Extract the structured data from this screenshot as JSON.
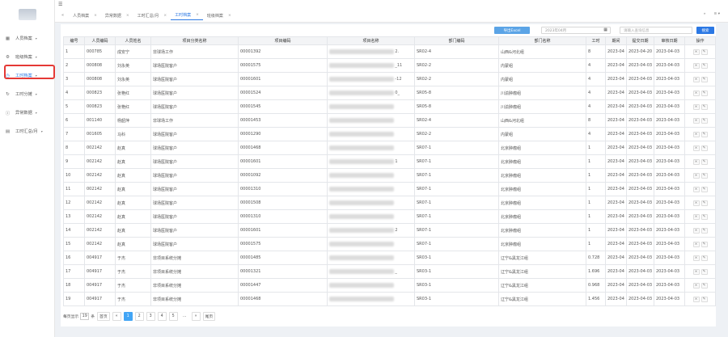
{
  "sidebar": {
    "items": [
      {
        "label": "人员档案",
        "icon": "grid-icon"
      },
      {
        "label": "班级档案",
        "icon": "settings-icon"
      },
      {
        "label": "工时档案",
        "icon": "clock-icon"
      },
      {
        "label": "工时分摊",
        "icon": "refresh-icon"
      },
      {
        "label": "异常数据",
        "icon": "info-icon"
      },
      {
        "label": "工时汇总/月",
        "icon": "calendar-icon"
      }
    ]
  },
  "tabs": [
    "人员档案",
    "异常数据",
    "工时汇总/月",
    "工时档案",
    "班级档案"
  ],
  "toolbar": {
    "export_label": "导出Excel",
    "month_value": "2023年04月",
    "search_placeholder": "请输入查询信息",
    "search_label": "搜索"
  },
  "columns": [
    "编号",
    "人员编码",
    "人员姓名",
    "项目分类名称",
    "项目编码",
    "项目名称",
    "部门编码",
    "部门名称",
    "工时",
    "期间",
    "提交日期",
    "审核日期",
    "操作"
  ],
  "rows": [
    {
      "no": "1",
      "code": "000785",
      "name": "成安宁",
      "cat": "非球场工作",
      "pcode": "00001392",
      "psfx": "2.",
      "dcode": "SR02-4",
      "dname": "山西&河北组",
      "hours": "8",
      "period": "2023-04",
      "submit": "2023-04-20",
      "audit": "2023-04-03"
    },
    {
      "no": "2",
      "code": "000808",
      "name": "刘永英",
      "cat": "球场医院客户",
      "pcode": "00001575",
      "psfx": "_11",
      "dcode": "SR02-2",
      "dname": "内蒙组",
      "hours": "4",
      "period": "2023-04",
      "submit": "2023-04-03",
      "audit": "2023-04-03"
    },
    {
      "no": "3",
      "code": "000808",
      "name": "刘永英",
      "cat": "球场医院客户",
      "pcode": "00001601",
      "psfx": "-12",
      "dcode": "SR02-2",
      "dname": "内蒙组",
      "hours": "4",
      "period": "2023-04",
      "submit": "2023-04-03",
      "audit": "2023-04-03"
    },
    {
      "no": "4",
      "code": "000823",
      "name": "张艳红",
      "cat": "球场医院客户",
      "pcode": "00001524",
      "psfx": "0_",
      "dcode": "SR05-8",
      "dname": "川渝肿瘤组",
      "hours": "4",
      "period": "2023-04",
      "submit": "2023-04-03",
      "audit": "2023-04-03"
    },
    {
      "no": "5",
      "code": "000823",
      "name": "张艳红",
      "cat": "球场医院客户",
      "pcode": "00001545",
      "psfx": "",
      "dcode": "SR05-8",
      "dname": "川渝肿瘤组",
      "hours": "4",
      "period": "2023-04",
      "submit": "2023-04-03",
      "audit": "2023-04-03"
    },
    {
      "no": "6",
      "code": "001140",
      "name": "杨韶萍",
      "cat": "非球场工作",
      "pcode": "00001453",
      "psfx": "",
      "dcode": "SR02-4",
      "dname": "山西&河北组",
      "hours": "8",
      "period": "2023-04",
      "submit": "2023-04-03",
      "audit": "2023-04-03"
    },
    {
      "no": "7",
      "code": "001605",
      "name": "马科",
      "cat": "球场医院客户",
      "pcode": "00001290",
      "psfx": "",
      "dcode": "SR02-2",
      "dname": "内蒙组",
      "hours": "4",
      "period": "2023-04",
      "submit": "2023-04-03",
      "audit": "2023-04-03"
    },
    {
      "no": "8",
      "code": "002142",
      "name": "赵真",
      "cat": "球场医院客户",
      "pcode": "00001468",
      "psfx": "",
      "dcode": "SR07-1",
      "dname": "北京肿瘤组",
      "hours": "1",
      "period": "2023-04",
      "submit": "2023-04-03",
      "audit": "2023-04-03"
    },
    {
      "no": "9",
      "code": "002142",
      "name": "赵真",
      "cat": "球场医院客户",
      "pcode": "00001601",
      "psfx": "1",
      "dcode": "SR07-1",
      "dname": "北京肿瘤组",
      "hours": "1",
      "period": "2023-04",
      "submit": "2023-04-03",
      "audit": "2023-04-03"
    },
    {
      "no": "10",
      "code": "002142",
      "name": "赵真",
      "cat": "球场医院客户",
      "pcode": "00001092",
      "psfx": "",
      "dcode": "SR07-1",
      "dname": "北京肿瘤组",
      "hours": "1",
      "period": "2023-04",
      "submit": "2023-04-03",
      "audit": "2023-04-03"
    },
    {
      "no": "11",
      "code": "002142",
      "name": "赵真",
      "cat": "球场医院客户",
      "pcode": "00001310",
      "psfx": "",
      "dcode": "SR07-1",
      "dname": "北京肿瘤组",
      "hours": "1",
      "period": "2023-04",
      "submit": "2023-04-03",
      "audit": "2023-04-03"
    },
    {
      "no": "12",
      "code": "002142",
      "name": "赵真",
      "cat": "球场医院客户",
      "pcode": "00001508",
      "psfx": "",
      "dcode": "SR07-1",
      "dname": "北京肿瘤组",
      "hours": "1",
      "period": "2023-04",
      "submit": "2023-04-03",
      "audit": "2023-04-03"
    },
    {
      "no": "13",
      "code": "002142",
      "name": "赵真",
      "cat": "球场医院客户",
      "pcode": "00001310",
      "psfx": "",
      "dcode": "SR07-1",
      "dname": "北京肿瘤组",
      "hours": "1",
      "period": "2023-04",
      "submit": "2023-04-03",
      "audit": "2023-04-03"
    },
    {
      "no": "14",
      "code": "002142",
      "name": "赵真",
      "cat": "球场医院客户",
      "pcode": "00001601",
      "psfx": "2",
      "dcode": "SR07-1",
      "dname": "北京肿瘤组",
      "hours": "1",
      "period": "2023-04",
      "submit": "2023-04-03",
      "audit": "2023-04-03"
    },
    {
      "no": "15",
      "code": "002142",
      "name": "赵真",
      "cat": "球场医院客户",
      "pcode": "00001575",
      "psfx": "",
      "dcode": "SR07-1",
      "dname": "北京肿瘤组",
      "hours": "1",
      "period": "2023-04",
      "submit": "2023-04-03",
      "audit": "2023-04-03"
    },
    {
      "no": "16",
      "code": "004917",
      "name": "于杰",
      "cat": "非项目系统分摊",
      "pcode": "00001485",
      "psfx": "",
      "dcode": "SR03-1",
      "dname": "辽宁&黑龙江组",
      "hours": "0.728",
      "period": "2023-04",
      "submit": "2023-04-03",
      "audit": "2023-04-03"
    },
    {
      "no": "17",
      "code": "004917",
      "name": "于杰",
      "cat": "非项目系统分摊",
      "pcode": "00001321",
      "psfx": "_",
      "dcode": "SR03-1",
      "dname": "辽宁&黑龙江组",
      "hours": "1.696",
      "period": "2023-04",
      "submit": "2023-04-03",
      "audit": "2023-04-03"
    },
    {
      "no": "18",
      "code": "004917",
      "name": "于杰",
      "cat": "非项目系统分摊",
      "pcode": "00001447",
      "psfx": "",
      "dcode": "SR03-1",
      "dname": "辽宁&黑龙江组",
      "hours": "0.968",
      "period": "2023-04",
      "submit": "2023-04-03",
      "audit": "2023-04-03"
    },
    {
      "no": "19",
      "code": "004917",
      "name": "于杰",
      "cat": "非项目系统分摊",
      "pcode": "00001468",
      "psfx": "",
      "dcode": "SR03-1",
      "dname": "辽宁&黑龙江组",
      "hours": "1.456",
      "period": "2023-04",
      "submit": "2023-04-03",
      "audit": "2023-04-03"
    }
  ],
  "pager": {
    "per_page_prefix": "每页显示",
    "per_page": "19",
    "per_page_suffix": "条",
    "first": "首页",
    "prev": "«",
    "pages": [
      "1",
      "2",
      "3",
      "4",
      "5"
    ],
    "ellipsis": "...",
    "next": "»",
    "last": "尾页"
  },
  "colors": {
    "accent": "#2b78e4",
    "highlight_box": "#e53935",
    "export_btn": "#5ba4e6"
  }
}
